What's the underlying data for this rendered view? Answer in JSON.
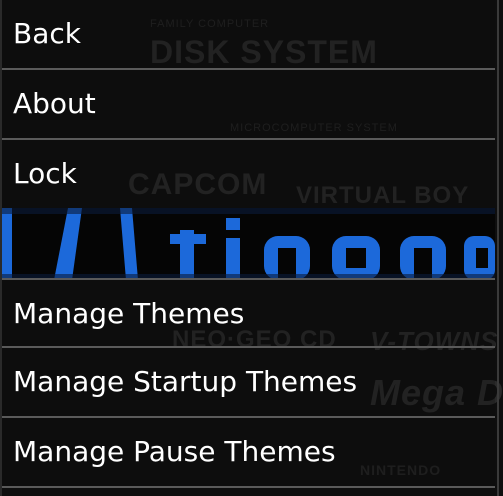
{
  "menu": {
    "items": [
      {
        "label": "Back"
      },
      {
        "label": "About"
      },
      {
        "label": "Lock"
      },
      {
        "label": "Manage Themes"
      },
      {
        "label": "Manage Startup Themes"
      },
      {
        "label": "Manage Pause Themes"
      }
    ]
  },
  "banner": {
    "accent_color": "#1e6fe6"
  },
  "background_logos": {
    "disk_system": "DISK SYSTEM",
    "family_computer": "FAMILY COMPUTER",
    "microcomputer": "MICROCOMPUTER SYSTEM",
    "capcom": "CAPCOM",
    "virtual_boy": "VIRTUAL BOY",
    "neo_geo_cd": "NEO·GEO CD",
    "v_towns": "V-TOWNS",
    "mega_duck": "Mega Duck",
    "nintendo": "NINTENDO"
  }
}
